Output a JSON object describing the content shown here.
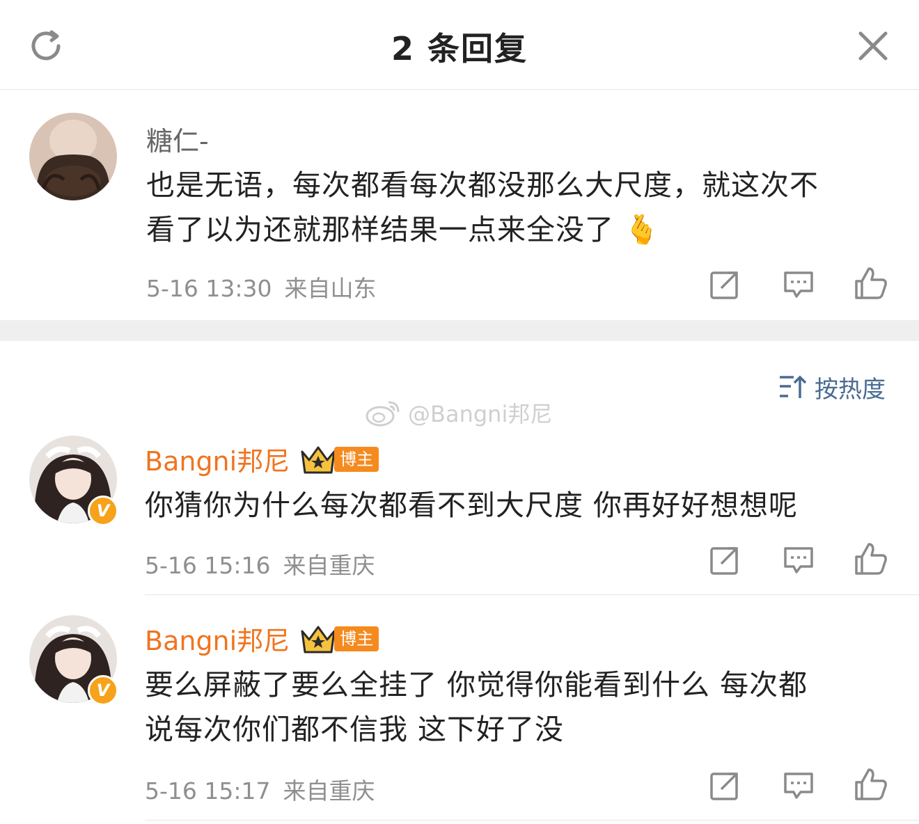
{
  "header": {
    "title": "2 条回复"
  },
  "root_comment": {
    "username": "糖仁-",
    "text_line1": "也是无语，每次都看每次都没那么大尺度，就这次不",
    "text_line2": "看了以为还就那样结果一点来全没了",
    "emoji": "🫰",
    "time": "5-16 13:30",
    "location": "来自山东"
  },
  "sort": {
    "label": "按热度"
  },
  "watermark": {
    "text": "@Bangni邦尼"
  },
  "replies": [
    {
      "username": "Bangni邦尼",
      "tag": "博主",
      "text_line1": "你猜你为什么每次都看不到大尺度  你再好好想想呢",
      "time": "5-16 15:16",
      "location": "来自重庆"
    },
    {
      "username": "Bangni邦尼",
      "tag": "博主",
      "text_line1": "要么屏蔽了要么全挂了  你觉得你能看到什么  每次都",
      "text_line2": "说每次你们都不信我  这下好了没",
      "time": "5-16 15:17",
      "location": "来自重庆"
    }
  ],
  "colors": {
    "vip_name": "#f0741f",
    "blogger_tag": "#f58a1f",
    "sort_text": "#4a6b93",
    "meta_text": "#8f8f8f",
    "verified_badge": "#f6a21a"
  },
  "icons": [
    "refresh-icon",
    "close-icon",
    "share-icon",
    "comment-icon",
    "like-icon",
    "sort-icon",
    "crown-icon",
    "verified-icon",
    "weibo-logo-icon"
  ]
}
